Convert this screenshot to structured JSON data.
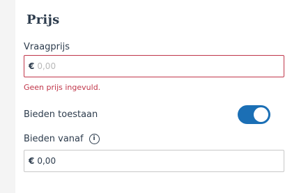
{
  "section": {
    "title": "Prijs"
  },
  "vraagprijs": {
    "label": "Vraagprijs",
    "currency": "€",
    "value": "",
    "placeholder": "0,00",
    "error": "Geen prijs ingevuld."
  },
  "bieden_toestaan": {
    "label": "Bieden toestaan",
    "enabled": true
  },
  "bieden_vanaf": {
    "label": "Bieden vanaf",
    "info_icon": "info-icon",
    "currency": "€",
    "value": "0,00"
  },
  "colors": {
    "error": "#c0364a",
    "toggle_on": "#1b6fb5",
    "text": "#2d3c4d"
  }
}
